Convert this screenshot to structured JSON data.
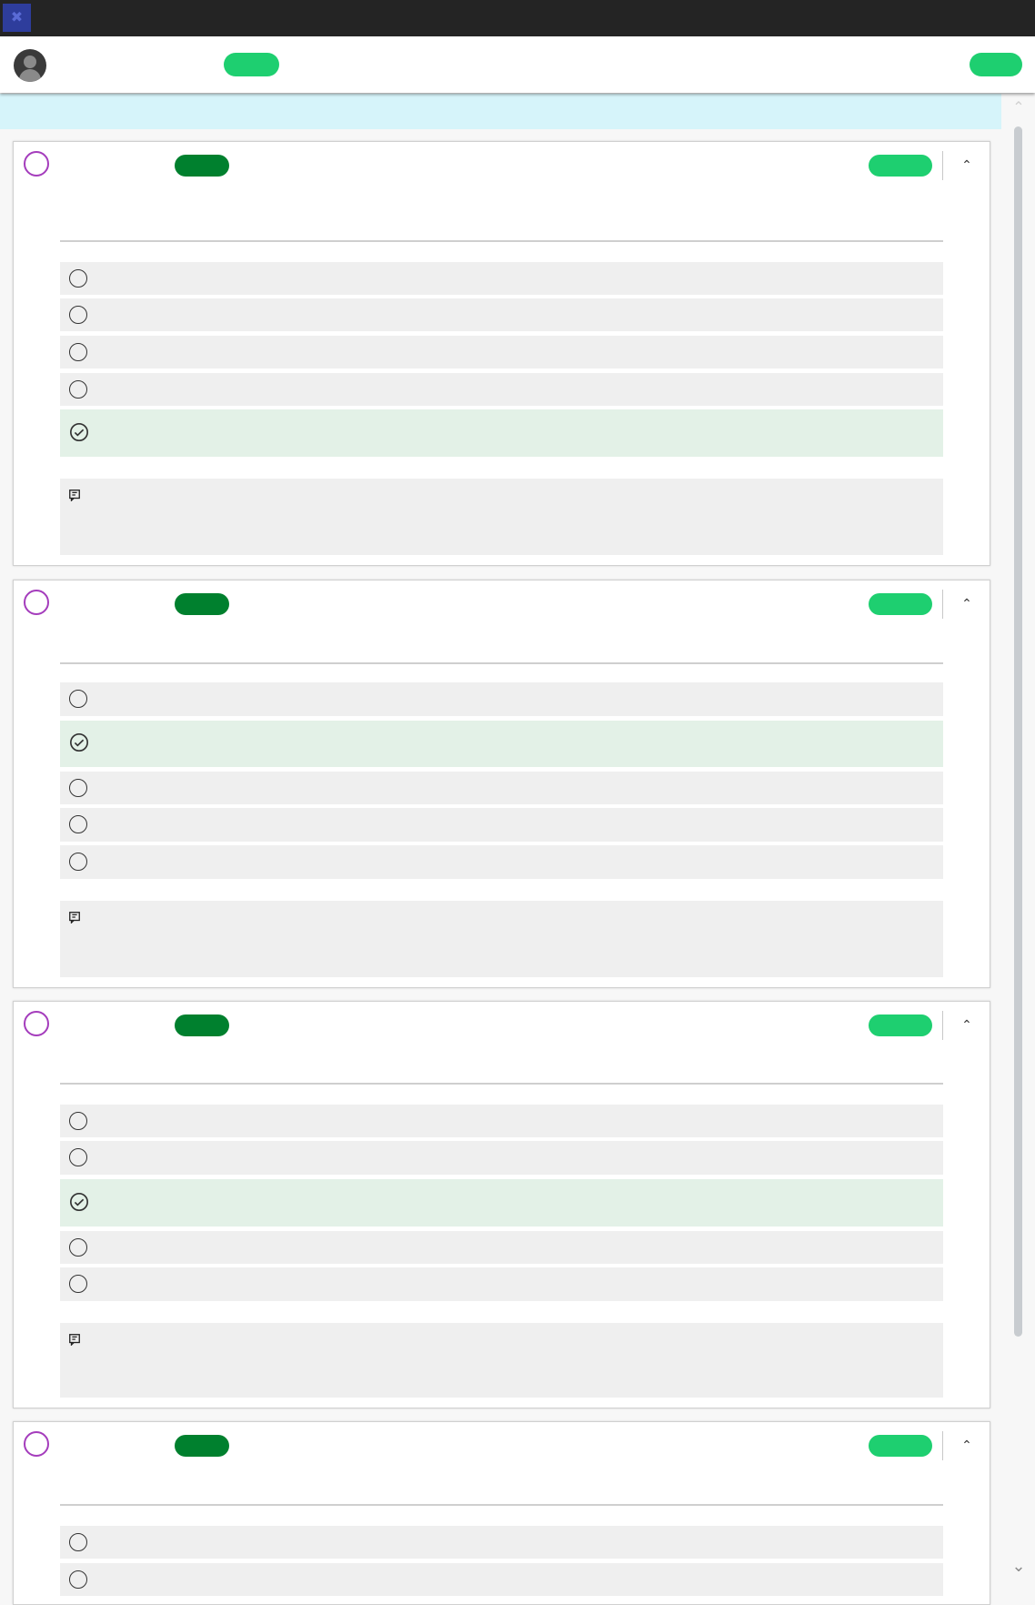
{
  "window": {
    "app_icon": "app-icon"
  },
  "header": {
    "avatar": "user-avatar",
    "badge_left": "",
    "badge_right": ""
  },
  "banner": {
    "text": ""
  },
  "scrollbar": {
    "up_icon": "chevron-up-icon",
    "down_icon": "chevron-down-icon"
  },
  "colors": {
    "question_ring": "#a43cbc",
    "pill_dark": "#00802e",
    "pill_light": "#1ecf70",
    "selected_option": "#e3f1e7",
    "banner": "#d6f4fa"
  },
  "questions": [
    {
      "number_badge": "",
      "status_badge": "",
      "text": "",
      "options": [
        "",
        "",
        "",
        "",
        ""
      ],
      "selected_index": 4,
      "feedback": ""
    },
    {
      "number_badge": "",
      "status_badge": "",
      "text": "",
      "options": [
        "",
        "",
        "",
        "",
        ""
      ],
      "selected_index": 1,
      "feedback": ""
    },
    {
      "number_badge": "",
      "status_badge": "",
      "text": "",
      "options": [
        "",
        "",
        "",
        "",
        ""
      ],
      "selected_index": 2,
      "feedback": ""
    },
    {
      "number_badge": "",
      "status_badge": "",
      "text": "",
      "options": [
        "",
        ""
      ],
      "selected_index": -1,
      "feedback": ""
    }
  ]
}
